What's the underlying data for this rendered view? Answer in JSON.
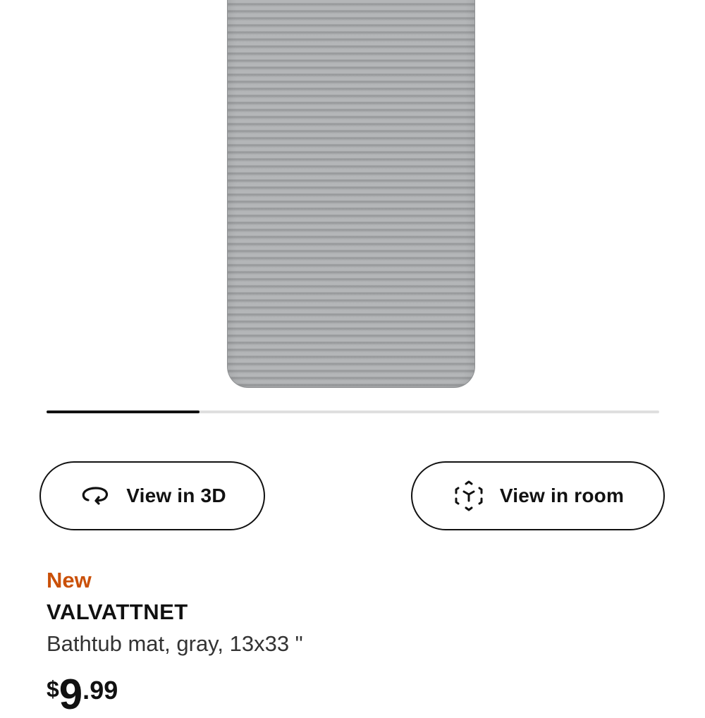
{
  "gallery": {
    "progress_fraction": 0.25
  },
  "actions": {
    "view_3d_label": "View in 3D",
    "view_room_label": "View in room",
    "view_3d_icon": "rotate-3d-icon",
    "view_room_icon": "ar-cube-icon"
  },
  "product": {
    "badge": "New",
    "name": "VALVATTNET",
    "description": "Bathtub mat, gray, 13x33 \"",
    "price": {
      "currency": "$",
      "integer": "9",
      "separator": ".",
      "decimal": "99"
    }
  },
  "colors": {
    "badge_new": "#ca5008",
    "text": "#111111",
    "mat": "#a6a8aa"
  }
}
